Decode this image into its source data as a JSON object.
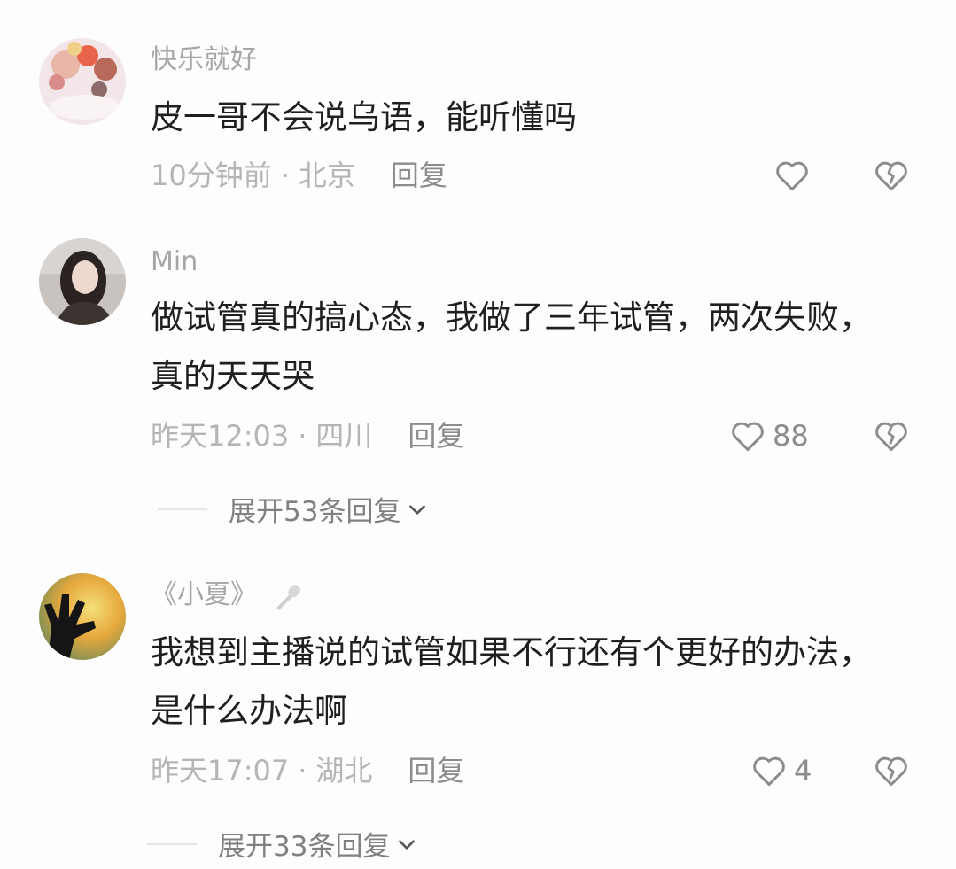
{
  "comments": [
    {
      "username": "快乐就好",
      "text": "皮一哥不会说乌语，能听懂吗",
      "time": "10分钟前",
      "location": "北京",
      "reply_label": "回复",
      "like_count": "",
      "avatar_icon": "flowers-avatar"
    },
    {
      "username": "Min",
      "text": "做试管真的搞心态，我做了三年试管，两次失败，真的天天哭",
      "time": "昨天12:03",
      "location": "四川",
      "reply_label": "回复",
      "like_count": "88",
      "expand_label": "展开53条回复",
      "avatar_icon": "woman-portrait-avatar"
    },
    {
      "username": "《小夏》",
      "text": "我想到主播说的试管如果不行还有个更好的办法，是什么办法啊",
      "time": "昨天17:07",
      "location": "湖北",
      "reply_label": "回复",
      "like_count": "4",
      "expand_label": "展开33条回复",
      "avatar_icon": "hand-silhouette-avatar"
    }
  ],
  "icons": {
    "like": "heart-outline-icon",
    "dislike": "broken-heart-icon",
    "expand": "chevron-down-icon",
    "badge": "microphone-icon"
  },
  "colors": {
    "text": "#1f1f1f",
    "username": "#a6a6a6",
    "meta": "#b5b5b5",
    "icon": "#8c8c8c"
  }
}
